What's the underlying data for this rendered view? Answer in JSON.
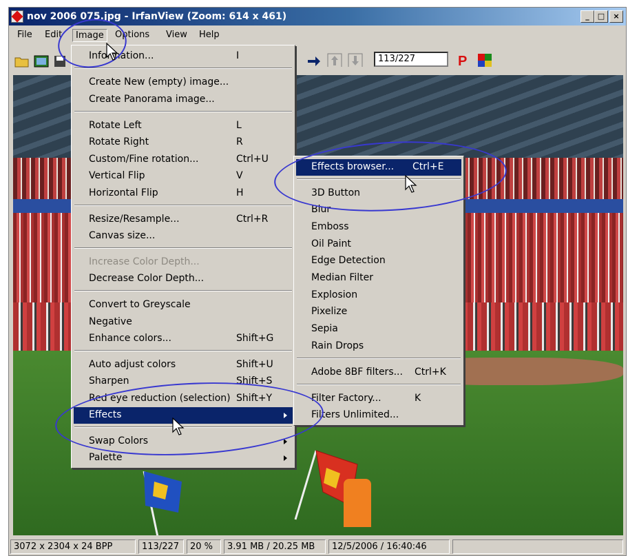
{
  "window": {
    "title": "nov 2006 075.jpg - IrfanView (Zoom: 614 x 461)",
    "buttons": {
      "minimize": "_",
      "maximize": "□",
      "close": "×"
    }
  },
  "menubar": [
    "File",
    "Edit",
    "Image",
    "Options",
    "View",
    "Help"
  ],
  "toolbar": {
    "frame_counter": "113/227",
    "icons": [
      "open-folder-icon",
      "slideshow-icon",
      "save-icon",
      "next-arrow-icon",
      "up-arrow-icon",
      "down-arrow-icon",
      "paint-icon",
      "color-palette-icon"
    ],
    "accent": "#d81010"
  },
  "image_menu": {
    "items": [
      {
        "label": "Information...",
        "shortcut": "I"
      },
      {
        "label": "Create New (empty) image...",
        "shortcut": ""
      },
      {
        "label": "Create Panorama image...",
        "shortcut": ""
      },
      {
        "label": "Rotate Left",
        "shortcut": "L"
      },
      {
        "label": "Rotate Right",
        "shortcut": "R"
      },
      {
        "label": "Custom/Fine rotation...",
        "shortcut": "Ctrl+U"
      },
      {
        "label": "Vertical Flip",
        "shortcut": "V"
      },
      {
        "label": "Horizontal Flip",
        "shortcut": "H"
      },
      {
        "label": "Resize/Resample...",
        "shortcut": "Ctrl+R"
      },
      {
        "label": "Canvas size...",
        "shortcut": ""
      },
      {
        "label": "Increase Color Depth...",
        "shortcut": "",
        "disabled": true
      },
      {
        "label": "Decrease Color Depth...",
        "shortcut": ""
      },
      {
        "label": "Convert to Greyscale",
        "shortcut": ""
      },
      {
        "label": "Negative",
        "shortcut": ""
      },
      {
        "label": "Enhance colors...",
        "shortcut": "Shift+G"
      },
      {
        "label": "Auto adjust colors",
        "shortcut": "Shift+U"
      },
      {
        "label": "Sharpen",
        "shortcut": "Shift+S"
      },
      {
        "label": "Red eye reduction (selection)",
        "shortcut": "Shift+Y"
      },
      {
        "label": "Effects",
        "shortcut": "",
        "submenu": true,
        "selected": true
      },
      {
        "label": "Swap Colors",
        "shortcut": "",
        "submenu": true
      },
      {
        "label": "Palette",
        "shortcut": "",
        "submenu": true
      }
    ]
  },
  "effects_menu": {
    "items": [
      {
        "label": "Effects browser...",
        "shortcut": "Ctrl+E",
        "selected": true
      },
      {
        "label": "3D Button",
        "shortcut": ""
      },
      {
        "label": "Blur",
        "shortcut": ""
      },
      {
        "label": "Emboss",
        "shortcut": ""
      },
      {
        "label": "Oil Paint",
        "shortcut": ""
      },
      {
        "label": "Edge Detection",
        "shortcut": ""
      },
      {
        "label": "Median Filter",
        "shortcut": ""
      },
      {
        "label": "Explosion",
        "shortcut": ""
      },
      {
        "label": "Pixelize",
        "shortcut": ""
      },
      {
        "label": "Sepia",
        "shortcut": ""
      },
      {
        "label": "Rain Drops",
        "shortcut": ""
      },
      {
        "label": "Adobe 8BF filters...",
        "shortcut": "Ctrl+K"
      },
      {
        "label": "Filter Factory...",
        "shortcut": "K"
      },
      {
        "label": "Filters Unlimited...",
        "shortcut": ""
      }
    ]
  },
  "statusbar": {
    "dimensions": "3072 x 2304 x 24 BPP",
    "index": "113/227",
    "zoom": "20 %",
    "memory": "3.91 MB / 20.25 MB",
    "datetime": "12/5/2006 / 16:40:46"
  },
  "colors": {
    "highlight": "#0a246a",
    "annotation": "#3838d0"
  }
}
